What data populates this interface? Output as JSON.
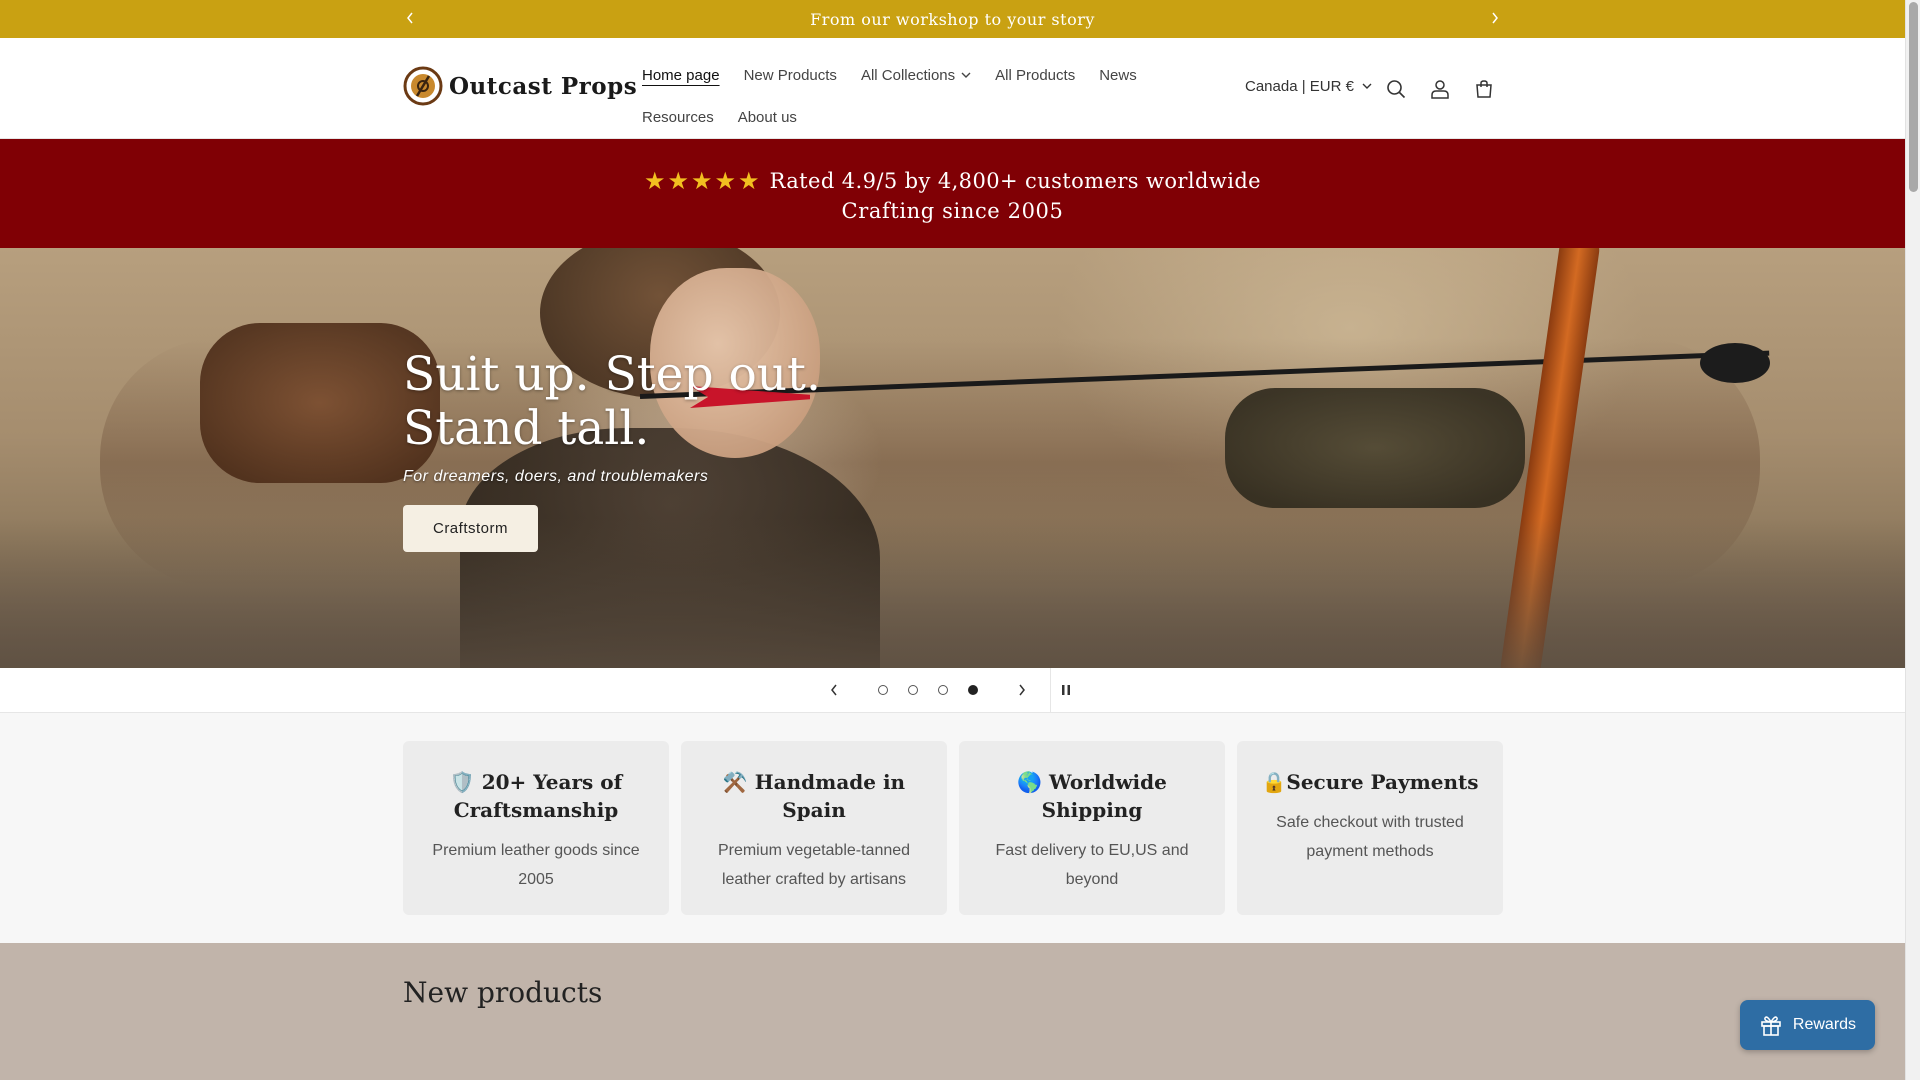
{
  "announcement": {
    "text": "From our workshop to your story"
  },
  "header": {
    "brand": "Outcast Props",
    "nav_row1": [
      {
        "label": "Home page"
      },
      {
        "label": "New Products"
      },
      {
        "label": "All Collections"
      },
      {
        "label": "All Products"
      },
      {
        "label": "News"
      }
    ],
    "nav_row2": [
      {
        "label": "Resources"
      },
      {
        "label": "About us"
      }
    ],
    "region": "Canada | EUR €"
  },
  "promo": {
    "stars": "★★★★★",
    "rating_text": "Rated 4.9/5 by 4,800+ customers worldwide",
    "since_text": "Crafting since 2005"
  },
  "hero": {
    "title": "Suit up. Step out. Stand tall.",
    "subtitle": "For dreamers, doers, and troublemakers",
    "button": "Craftstorm",
    "slides_count": 4,
    "active_slide": 4
  },
  "features": [
    {
      "icon": "🛡️",
      "title": "20+ Years of Craftsmanship",
      "desc": "Premium leather goods since 2005"
    },
    {
      "icon": "⚒️",
      "title": "Handmade in Spain",
      "desc": "Premium vegetable-tanned leather crafted by artisans"
    },
    {
      "icon": "🌎",
      "title": "Worldwide Shipping",
      "desc": "Fast delivery to EU,US and beyond"
    },
    {
      "icon": "🔒",
      "title": "Secure Payments",
      "desc": "Safe checkout with trusted payment methods"
    }
  ],
  "new_products": {
    "heading": "New products"
  },
  "rewards": {
    "label": "Rewards"
  },
  "colors": {
    "announcement_bg": "#c9a112",
    "promo_bg": "#800005",
    "star": "#f2bf20",
    "rewards_bg": "#2e6da4",
    "new_products_bg": "#c1b4aa"
  }
}
